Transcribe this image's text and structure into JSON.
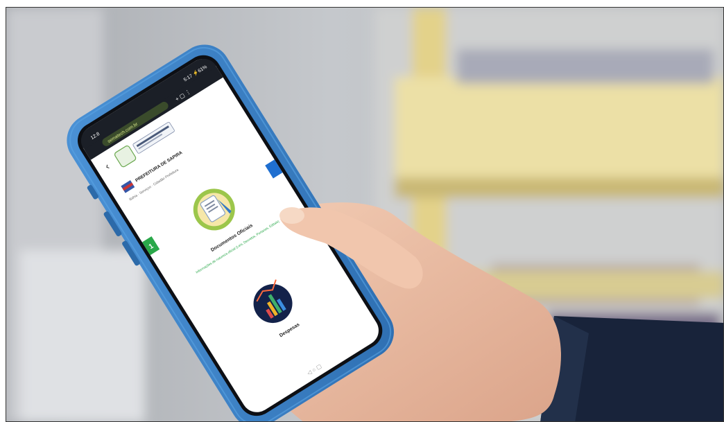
{
  "phone": {
    "status": {
      "time": "12:8",
      "right": "5:17 ⚡61%"
    },
    "browser": {
      "url": "sematech.com.br"
    },
    "header": {
      "back": "‹"
    },
    "prefeitura": {
      "title": "PREFEITURA DE SAPIRA",
      "subtitle": "Bahia · Serviços · Cidadão Prefeitura"
    },
    "cards": [
      {
        "title": "Documentos Oficiais",
        "subtitle": "Informações de natureza oficial (Leis, Decretos, Portarias, Editais)"
      },
      {
        "title": "Despesas"
      }
    ],
    "side_tabs": {
      "left": "1"
    }
  },
  "colors": {
    "case": "#3a7fc4",
    "case_dark": "#1f5d9c",
    "screen": "#ffffff",
    "accent_green": "#2aa84a",
    "accent_blue": "#1f6fd0",
    "wall": "#b9bcc0",
    "shelf_yellow": "#e7dc9f",
    "sleeve": "#1a2437"
  }
}
